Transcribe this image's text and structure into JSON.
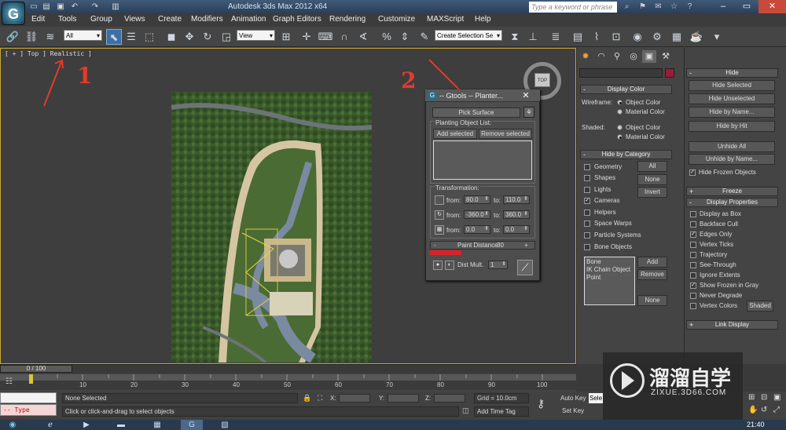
{
  "titlebar": {
    "title": "Autodesk 3ds Max  2012 x64",
    "search_placeholder": "Type a keyword or phrase",
    "quick_access": [
      "📄",
      "📂",
      "💾",
      "↶",
      "↷",
      "🔲"
    ]
  },
  "menu": [
    "Edit",
    "Tools",
    "Group",
    "Views",
    "Create",
    "Modifiers",
    "Animation",
    "Graph Editors",
    "Rendering",
    "Customize",
    "MAXScript",
    "Help"
  ],
  "toolbar": {
    "filter_value": "All",
    "refcoord_value": "View",
    "selection_set_placeholder": "Create Selection Se"
  },
  "viewport": {
    "label": "[ + ] Top ] Realistic ]",
    "viewcube_face": "TOP"
  },
  "planter": {
    "title": "-- Gtools -- Planter...",
    "pick_surface": "Pick Surface",
    "planting_list_label": "Planting Object List:",
    "add_selected": "Add selected",
    "remove_selected": "Remove selected",
    "transformation_label": "Transformation:",
    "rows": [
      {
        "from_label": "from:",
        "from": "80.0",
        "to_label": "to:",
        "to": "110.0"
      },
      {
        "from_label": "from:",
        "from": "-360.0",
        "to_label": "to:",
        "to": "360.0"
      },
      {
        "from_label": "from:",
        "from": "0.0",
        "to_label": "to:",
        "to": "0.0"
      }
    ],
    "paint_distance_minus": "-",
    "paint_distance_label": "Paint Distance",
    "paint_distance_value": "30",
    "paint_distance_plus": "+",
    "dist_mult_label": "Dist Mult.",
    "dist_mult_value": "1"
  },
  "command_panel": {
    "display_color": {
      "head": "Display Color",
      "wireframe_label": "Wireframe:",
      "shaded_label": "Shaded:",
      "object_color": "Object Color",
      "material_color": "Material Color"
    },
    "hide_by_category": {
      "head": "Hide by Category",
      "items": [
        {
          "label": "Geometry",
          "checked": false
        },
        {
          "label": "Shapes",
          "checked": false
        },
        {
          "label": "Lights",
          "checked": false
        },
        {
          "label": "Cameras",
          "checked": true
        },
        {
          "label": "Helpers",
          "checked": false
        },
        {
          "label": "Space Warps",
          "checked": false
        },
        {
          "label": "Particle Systems",
          "checked": false
        },
        {
          "label": "Bone Objects",
          "checked": false
        }
      ],
      "all": "All",
      "none": "None",
      "invert": "Invert",
      "list": [
        "Bone",
        "IK Chain Object",
        "Point"
      ],
      "add": "Add",
      "remove": "Remove",
      "none2": "None"
    }
  },
  "right_panel": {
    "hide": {
      "head": "Hide",
      "buttons": [
        "Hide Selected",
        "Hide Unselected",
        "Hide by Name...",
        "Hide by Hit",
        "Unhide All",
        "Unhide by Name..."
      ],
      "hide_frozen": "Hide Frozen Objects"
    },
    "freeze_head": "Freeze",
    "display_properties": {
      "head": "Display Properties",
      "items": [
        {
          "label": "Display as Box",
          "checked": false
        },
        {
          "label": "Backface Cull",
          "checked": false
        },
        {
          "label": "Edges Only",
          "checked": true
        },
        {
          "label": "Vertex Ticks",
          "checked": false
        },
        {
          "label": "Trajectory",
          "checked": false
        },
        {
          "label": "See-Through",
          "checked": false
        },
        {
          "label": "Ignore Extents",
          "checked": false
        },
        {
          "label": "Show Frozen in Gray",
          "checked": true
        },
        {
          "label": "Never Degrade",
          "checked": false
        },
        {
          "label": "Vertex Colors",
          "checked": false
        }
      ],
      "shaded_btn": "Shaded"
    },
    "link_display_head": "Link Display"
  },
  "timeline": {
    "slider": "0 / 100",
    "ticks": [
      "10",
      "20",
      "30",
      "40",
      "50",
      "60",
      "70",
      "80",
      "90",
      "100"
    ]
  },
  "status": {
    "selection": "None Selected",
    "prompt": "Click or click-and-drag to select objects",
    "script_error": "-- Type error:",
    "x_label": "X:",
    "y_label": "Y:",
    "z_label": "Z:",
    "grid": "Grid = 10.0cm",
    "add_time_tag": "Add Time Tag",
    "auto_key": "Auto Key",
    "set_key": "Set Key",
    "selected_dd": "Sele",
    "clock": "21:40"
  },
  "annotations": {
    "one": "1",
    "two": "2"
  },
  "watermark": {
    "title": "溜溜自学",
    "url": "ZIXUE.3D66.COM"
  },
  "colors": {
    "accent": "#c8a832",
    "annotation": "#e23b2d",
    "swatch": "#9a1c3a"
  }
}
